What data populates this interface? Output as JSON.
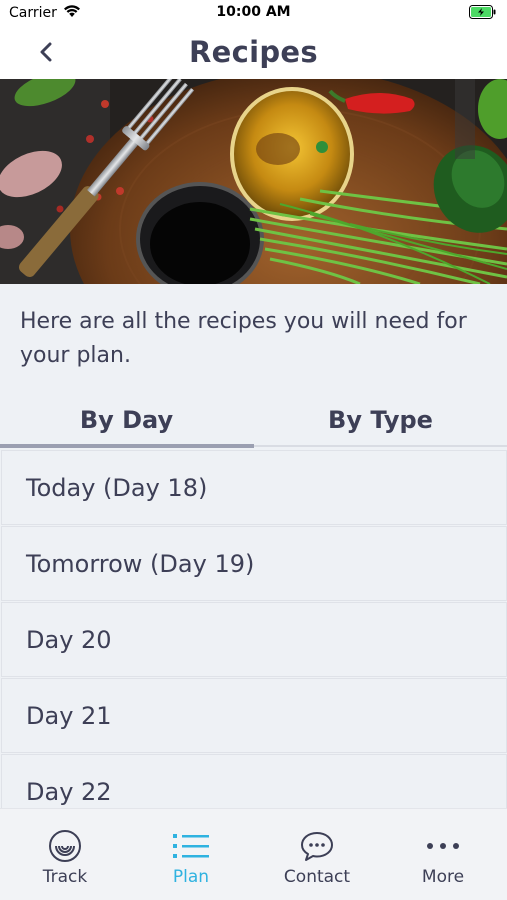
{
  "status_bar": {
    "carrier": "Carrier",
    "time": "10:00 AM"
  },
  "nav": {
    "title": "Recipes"
  },
  "intro": {
    "text": "Here are all the recipes you will need for your plan."
  },
  "tabs": [
    {
      "label": "By Day",
      "active": true
    },
    {
      "label": "By Type",
      "active": false
    }
  ],
  "days": [
    {
      "label": "Today (Day 18)"
    },
    {
      "label": "Tomorrow (Day 19)"
    },
    {
      "label": "Day 20"
    },
    {
      "label": "Day 21"
    },
    {
      "label": "Day 22"
    }
  ],
  "tab_bar": {
    "items": [
      {
        "label": "Track",
        "icon": "track-icon",
        "active": false
      },
      {
        "label": "Plan",
        "icon": "list-icon",
        "active": true
      },
      {
        "label": "Contact",
        "icon": "chat-bubble-icon",
        "active": false
      },
      {
        "label": "More",
        "icon": "more-dots-icon",
        "active": false
      }
    ]
  },
  "colors": {
    "accent": "#2fb2e0",
    "text": "#3d3f56",
    "background": "#eef1f5",
    "battery": "#4cd964"
  }
}
